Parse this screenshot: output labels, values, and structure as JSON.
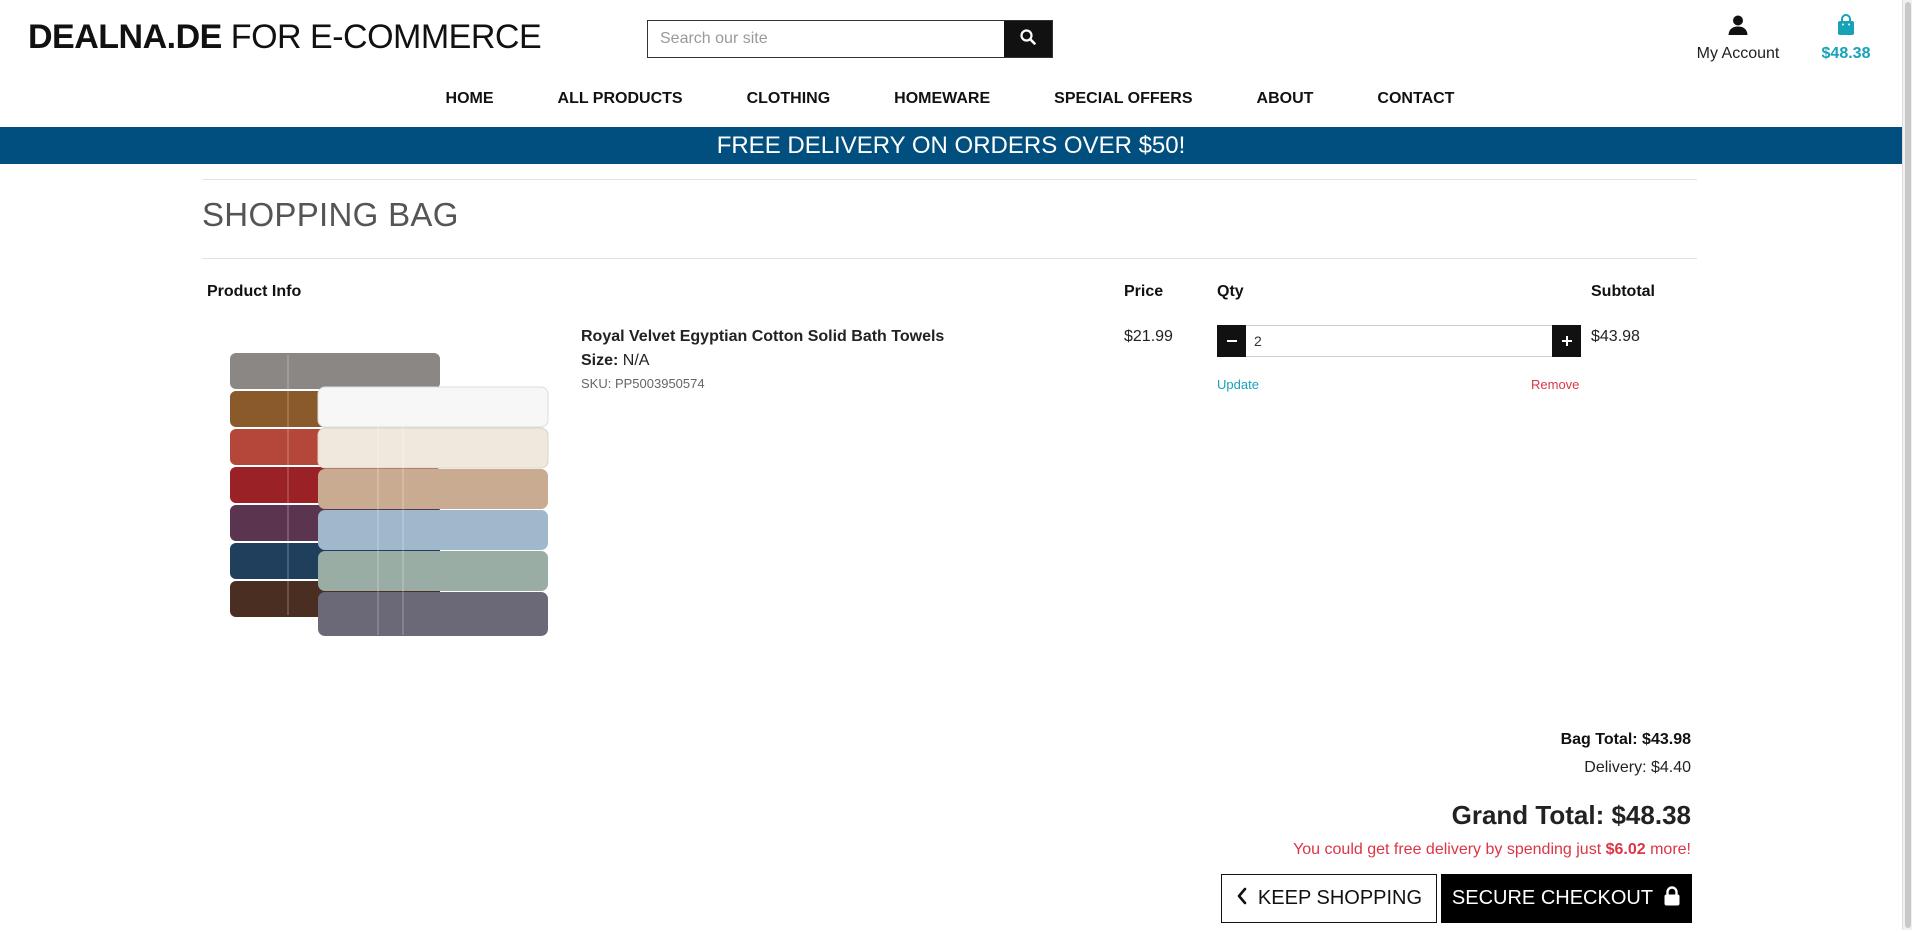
{
  "header": {
    "logo_bold": "DEALNA.DE",
    "logo_rest": "FOR E-COMMERCE",
    "search_placeholder": "Search our site",
    "account_label": "My Account",
    "bag_total": "$48.38"
  },
  "nav": {
    "items": [
      "HOME",
      "ALL PRODUCTS",
      "CLOTHING",
      "HOMEWARE",
      "SPECIAL OFFERS",
      "ABOUT",
      "CONTACT"
    ]
  },
  "banner": "FREE DELIVERY ON ORDERS OVER $50!",
  "page_title": "SHOPPING BAG",
  "table": {
    "headers": {
      "product_info": "Product Info",
      "price": "Price",
      "qty": "Qty",
      "subtotal": "Subtotal"
    }
  },
  "item": {
    "name": "Royal Velvet Egyptian Cotton Solid Bath Towels",
    "size_label": "Size:",
    "size_value": "N/A",
    "sku": "SKU: PP5003950574",
    "price": "$21.99",
    "qty": "2",
    "update_label": "Update",
    "remove_label": "Remove",
    "subtotal": "$43.98"
  },
  "summary": {
    "bag_total": "Bag Total: $43.98",
    "delivery": "Delivery: $4.40",
    "grand_total": "Grand Total: $48.38",
    "free_msg_pre": "You could get free delivery by spending just",
    "free_msg_amount": "$6.02",
    "free_msg_post": "more!"
  },
  "buttons": {
    "keep_shopping": "KEEP SHOPPING",
    "checkout": "SECURE CHECKOUT"
  },
  "colors": {
    "banner": "#004f7f",
    "accent": "#17a2b8",
    "danger": "#dc3545"
  },
  "icons": [
    "search-icon",
    "user-icon",
    "shopping-bag-icon",
    "minus-icon",
    "plus-icon",
    "chevron-left-icon",
    "lock-icon"
  ]
}
